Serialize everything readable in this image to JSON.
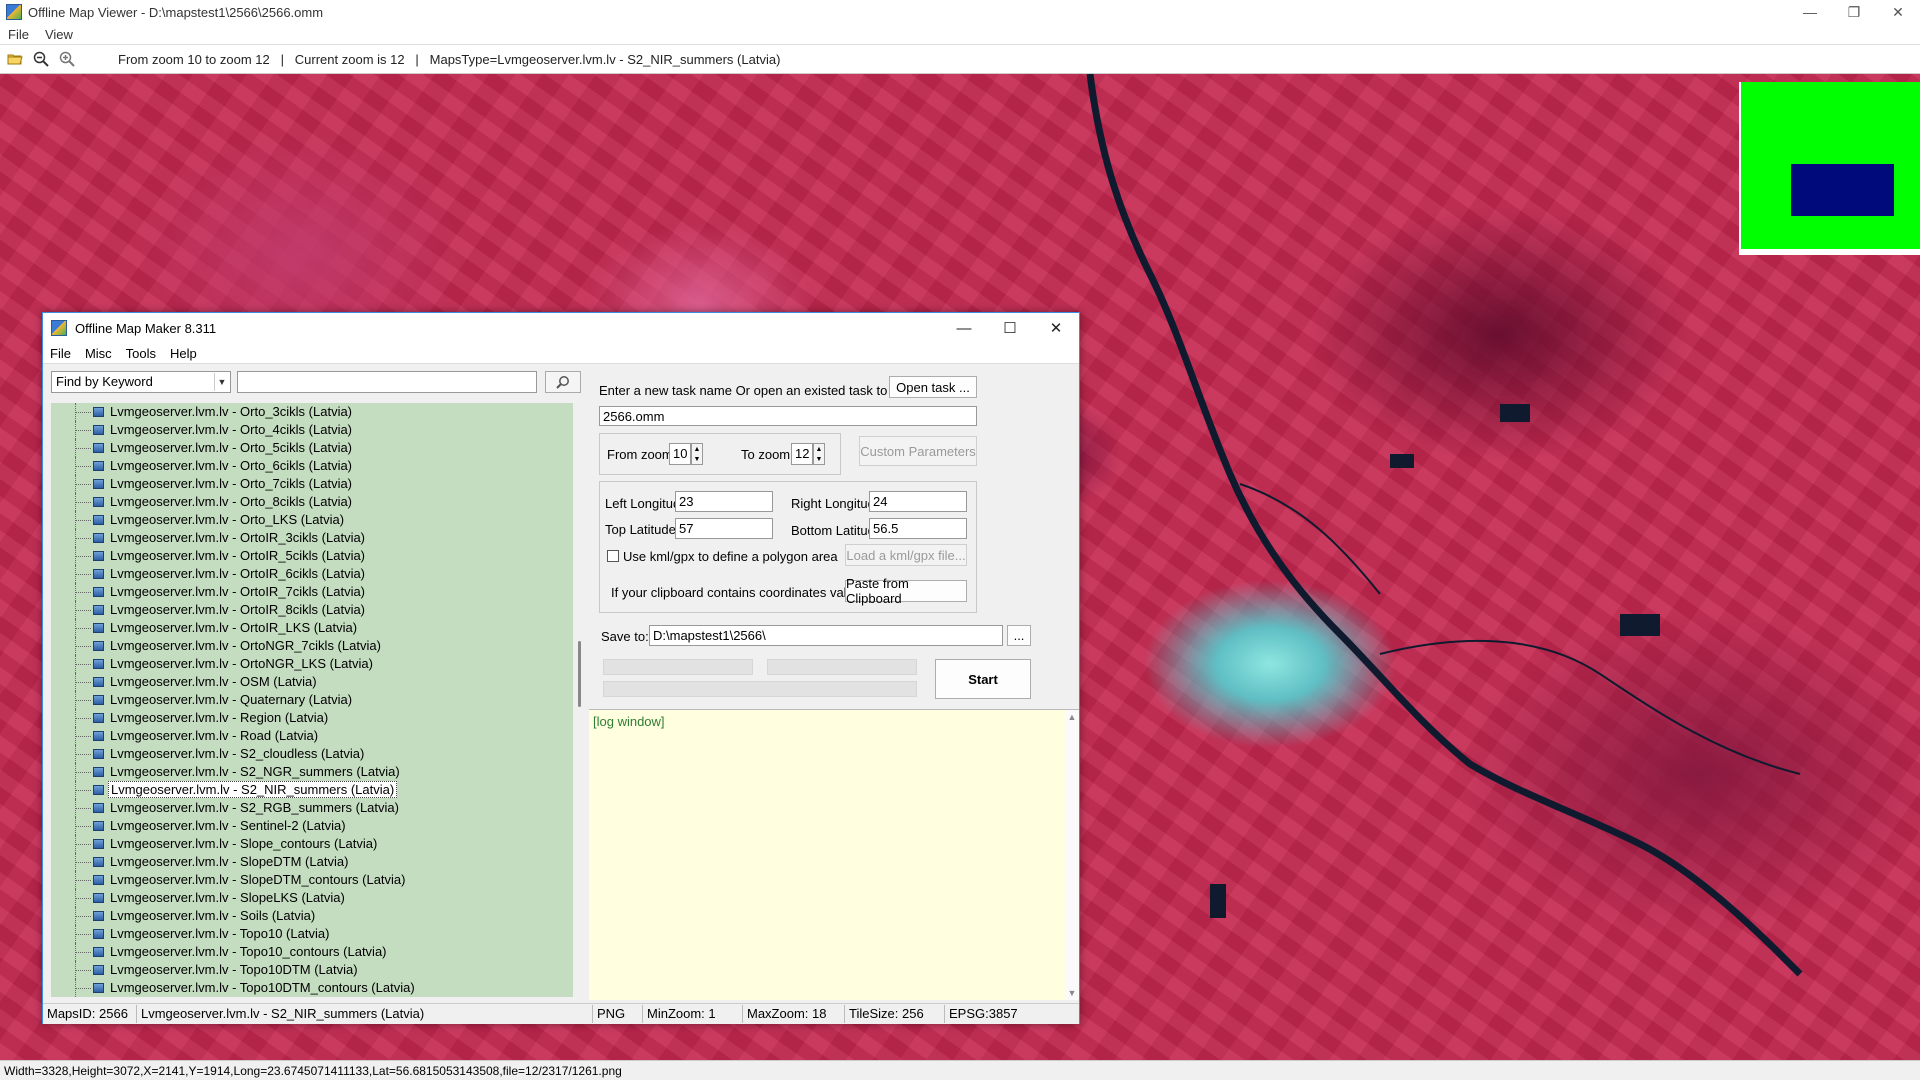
{
  "window": {
    "title": "Offline Map Viewer - D:\\mapstest1\\2566\\2566.omm",
    "controls": {
      "minimize": "—",
      "maximize": "❐",
      "close": "✕"
    }
  },
  "menu": {
    "items": [
      "File",
      "View"
    ]
  },
  "toolbar": {
    "icons": [
      "open-folder-icon",
      "zoom-out-icon",
      "zoom-in-icon"
    ],
    "status": "From zoom 10 to zoom 12   |   Current zoom is 12   |   MapsType=Lvmgeoserver.lvm.lv - S2_NIR_summers (Latvia)"
  },
  "bottom_status": "Width=3328,Height=3072,X=2141,Y=1914,Long=23.6745071411133,Lat=56.6815053143508,file=12/2317/1261.png",
  "colors": {
    "map_base": "#c2294f",
    "minimap_bg": "#00ff00",
    "minimap_viewport": "#000a7a",
    "tree_bg": "#c4dcc0",
    "log_bg": "#ffffe0",
    "log_text": "#2e7d32",
    "dialog_border": "#3a8de0"
  },
  "dialog": {
    "title": "Offline Map Maker 8.311",
    "controls": {
      "minimize": "—",
      "maximize": "☐",
      "close": "✕"
    },
    "menu": [
      "File",
      "Misc",
      "Tools",
      "Help"
    ],
    "search": {
      "mode": "Find by Keyword",
      "query": "",
      "button_icon": "search-icon"
    },
    "map_list": [
      "Lvmgeoserver.lvm.lv - Orto_3cikls (Latvia)",
      "Lvmgeoserver.lvm.lv - Orto_4cikls (Latvia)",
      "Lvmgeoserver.lvm.lv - Orto_5cikls (Latvia)",
      "Lvmgeoserver.lvm.lv - Orto_6cikls (Latvia)",
      "Lvmgeoserver.lvm.lv - Orto_7cikls (Latvia)",
      "Lvmgeoserver.lvm.lv - Orto_8cikls (Latvia)",
      "Lvmgeoserver.lvm.lv - Orto_LKS (Latvia)",
      "Lvmgeoserver.lvm.lv - OrtoIR_3cikls (Latvia)",
      "Lvmgeoserver.lvm.lv - OrtoIR_5cikls (Latvia)",
      "Lvmgeoserver.lvm.lv - OrtoIR_6cikls (Latvia)",
      "Lvmgeoserver.lvm.lv - OrtoIR_7cikls (Latvia)",
      "Lvmgeoserver.lvm.lv - OrtoIR_8cikls (Latvia)",
      "Lvmgeoserver.lvm.lv - OrtoIR_LKS (Latvia)",
      "Lvmgeoserver.lvm.lv - OrtoNGR_7cikls (Latvia)",
      "Lvmgeoserver.lvm.lv - OrtoNGR_LKS (Latvia)",
      "Lvmgeoserver.lvm.lv - OSM (Latvia)",
      "Lvmgeoserver.lvm.lv - Quaternary (Latvia)",
      "Lvmgeoserver.lvm.lv - Region (Latvia)",
      "Lvmgeoserver.lvm.lv - Road (Latvia)",
      "Lvmgeoserver.lvm.lv - S2_cloudless (Latvia)",
      "Lvmgeoserver.lvm.lv - S2_NGR_summers (Latvia)",
      "Lvmgeoserver.lvm.lv - S2_NIR_summers (Latvia)",
      "Lvmgeoserver.lvm.lv - S2_RGB_summers (Latvia)",
      "Lvmgeoserver.lvm.lv - Sentinel-2 (Latvia)",
      "Lvmgeoserver.lvm.lv - Slope_contours (Latvia)",
      "Lvmgeoserver.lvm.lv - SlopeDTM (Latvia)",
      "Lvmgeoserver.lvm.lv - SlopeDTM_contours (Latvia)",
      "Lvmgeoserver.lvm.lv - SlopeLKS (Latvia)",
      "Lvmgeoserver.lvm.lv - Soils (Latvia)",
      "Lvmgeoserver.lvm.lv - Topo10 (Latvia)",
      "Lvmgeoserver.lvm.lv - Topo10_contours (Latvia)",
      "Lvmgeoserver.lvm.lv - Topo10DTM (Latvia)",
      "Lvmgeoserver.lvm.lv - Topo10DTM_contours (Latvia)"
    ],
    "selected_map": "Lvmgeoserver.lvm.lv - S2_NIR_summers (Latvia)",
    "task": {
      "prompt": "Enter a new task name Or open an existed task to continue:",
      "open_button": "Open task ...",
      "name": "2566.omm"
    },
    "zoom": {
      "from_label": "From zoom",
      "from_value": "10",
      "to_label": "To zoom",
      "to_value": "12",
      "custom_button": "Custom Parameters"
    },
    "coords": {
      "left_lon_label": "Left Longitude",
      "left_lon": "23",
      "right_lon_label": "Right Longitude",
      "right_lon": "24",
      "top_lat_label": "Top Latitude",
      "top_lat": "57",
      "bottom_lat_label": "Bottom Latitude",
      "bottom_lat": "56.5"
    },
    "kml": {
      "checkbox_label": "Use kml/gpx to define a polygon area",
      "checked": false,
      "load_button": "Load a kml/gpx file..."
    },
    "clipboard": {
      "label": "If your clipboard contains coordinates values:",
      "button": "Paste from Clipboard"
    },
    "save": {
      "label": "Save to:",
      "path": "D:\\mapstest1\\2566\\",
      "browse_button": "..."
    },
    "start_button": "Start",
    "log": "[log window]",
    "status": {
      "maps_id": "MapsID: 2566",
      "maps_name": "Lvmgeoserver.lvm.lv - S2_NIR_summers (Latvia)",
      "format": "PNG",
      "min_zoom": "MinZoom: 1",
      "max_zoom": "MaxZoom: 18",
      "tile_size": "TileSize: 256",
      "epsg": "EPSG:3857"
    }
  }
}
